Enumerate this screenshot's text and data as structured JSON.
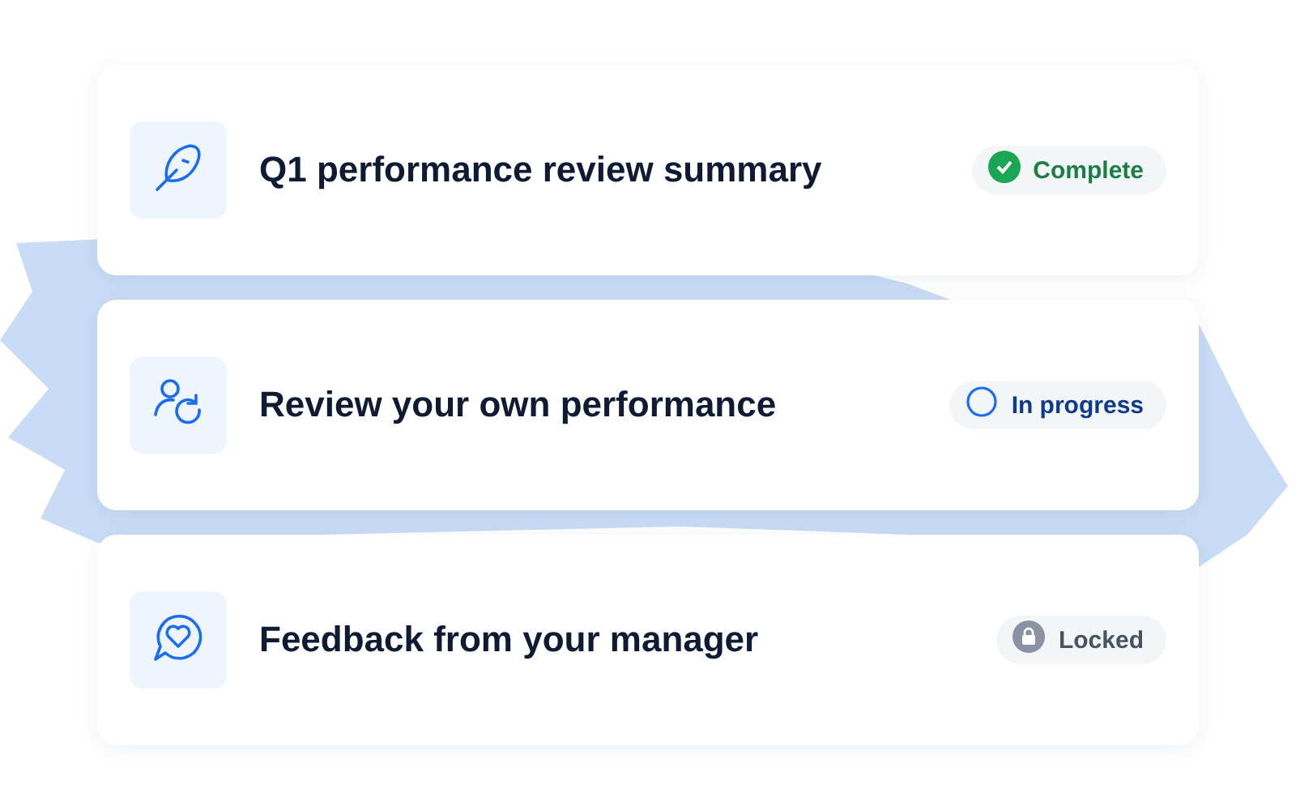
{
  "tasks": [
    {
      "title": "Q1 performance review summary",
      "status": {
        "kind": "complete",
        "label": "Complete"
      }
    },
    {
      "title": "Review your own performance",
      "status": {
        "kind": "in_progress",
        "label": "In progress"
      }
    },
    {
      "title": "Feedback from your manager",
      "status": {
        "kind": "locked",
        "label": "Locked"
      }
    }
  ]
}
